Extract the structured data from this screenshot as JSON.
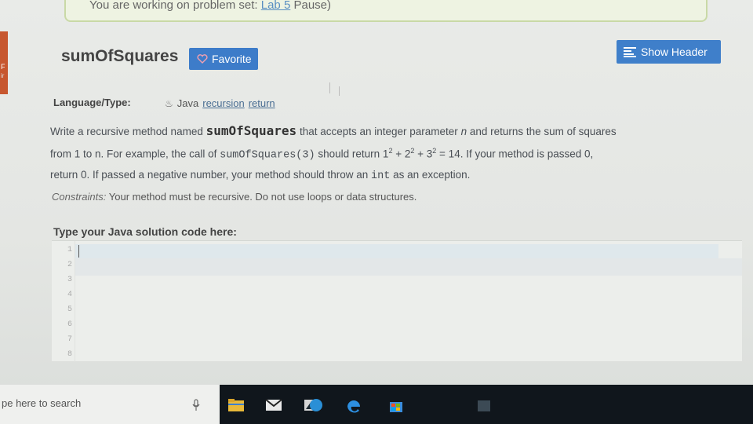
{
  "notice": {
    "text_prefix": "You are working on problem set:",
    "link_text": "Lab 5",
    "pause_text": "Pause)"
  },
  "sidebar_fragment": {
    "char1": "F",
    "char2": "ir"
  },
  "problem": {
    "title": "sumOfSquares",
    "favorite_label": "Favorite",
    "show_header_label": "Show Header"
  },
  "language": {
    "label": "Language/Type:",
    "lang": "Java",
    "tags": [
      "recursion",
      "return"
    ]
  },
  "description": {
    "p1_a": "Write a recursive method named ",
    "p1_method": "sumOfSquares",
    "p1_b": " that accepts an integer parameter ",
    "p1_n": "n",
    "p1_c": " and returns the sum of squares",
    "p2_a": "from 1 to n. For example, the call of ",
    "p2_call": "sumOfSquares(3)",
    "p2_b": " should return 1",
    "p2_b_sup": "2",
    "p2_c": " + 2",
    "p2_c_sup": "2",
    "p2_d": " + 3",
    "p2_d_sup": "2",
    "p2_e": " = 14. If your method is passed 0,",
    "p3_a": "return 0. If passed a negative number, your method should throw an ",
    "p3_int": "int",
    "p3_b": " as an exception."
  },
  "constraints": {
    "label": "Constraints:",
    "text": " Your method must be recursive. Do not use loops or data structures."
  },
  "editor": {
    "prompt": "Type your Java solution code here:",
    "line_numbers": [
      "1",
      "2",
      "3",
      "4",
      "5",
      "6",
      "7",
      "8"
    ]
  },
  "taskbar": {
    "search_placeholder": "pe here to search",
    "icons": [
      "mic-icon",
      "task-view-icon",
      "file-explorer-icon",
      "mail-icon",
      "store-icon",
      "edge-icon",
      "windows-store-bag-icon"
    ]
  }
}
